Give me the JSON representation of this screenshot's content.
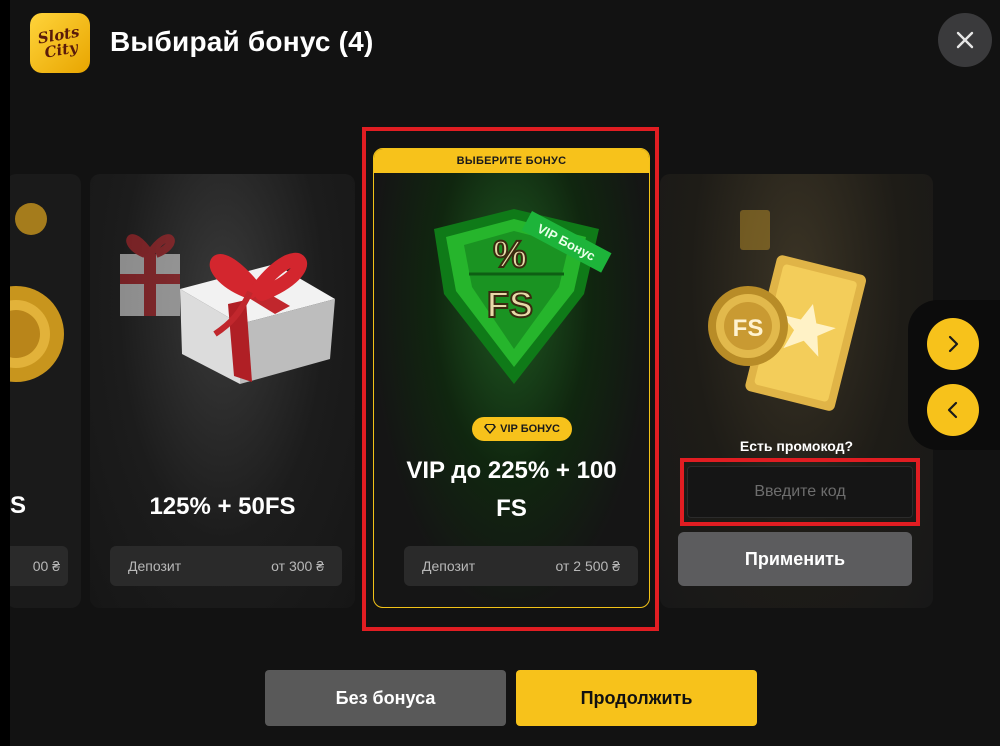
{
  "header": {
    "logo_text_1": "Slots",
    "logo_text_2": "City",
    "title": "Выбирай бонус (4)",
    "close_icon": "close-icon"
  },
  "cards": {
    "partial": {
      "title_fragment": "S",
      "deposit_fragment": "00 ₴"
    },
    "gift": {
      "title": "125% + 50FS",
      "deposit_label": "Депозит",
      "deposit_value": "от 300 ₴",
      "image": "gift-boxes-image"
    },
    "vip": {
      "header": "ВЫБЕРИТЕ БОНУС",
      "shield_ribbon": "VIP Бонус",
      "shield_top": "%",
      "shield_bottom": "FS",
      "badge": "VIP БОНУС",
      "title_line1": "VIP до 225% + 100",
      "title_line2": "FS",
      "deposit_label": "Депозит",
      "deposit_value": "от 2 500 ₴",
      "selected": true
    },
    "promo": {
      "coin_text": "FS",
      "label": "Есть промокод?",
      "input_placeholder": "Введите код",
      "input_value": "",
      "apply_label": "Применить"
    }
  },
  "nav": {
    "next_icon": "chevron-right-icon",
    "prev_icon": "chevron-left-icon"
  },
  "footer": {
    "no_bonus_label": "Без бонуса",
    "continue_label": "Продолжить"
  },
  "colors": {
    "accent": "#f7c21b",
    "highlight": "#e11d22",
    "background": "#121212"
  }
}
